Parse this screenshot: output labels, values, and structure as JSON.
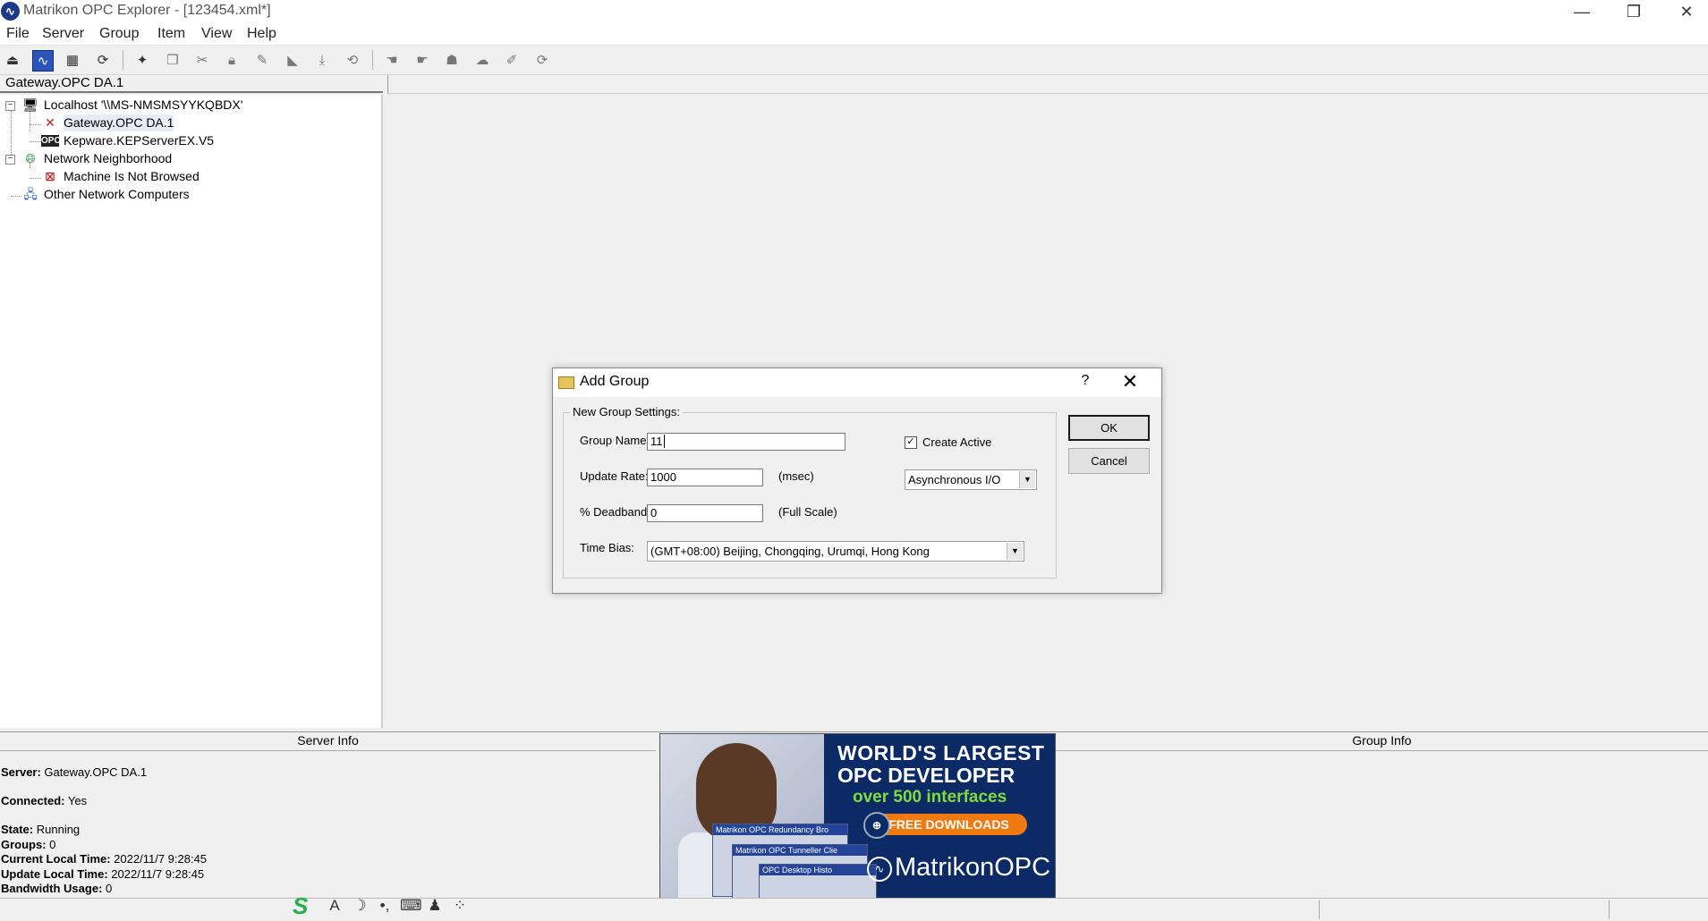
{
  "window": {
    "title": "Matrikon OPC Explorer - [123454.xml*]",
    "minimize_glyph": "—",
    "restore_glyph": "❐",
    "close_glyph": "✕"
  },
  "menu": [
    "File",
    "Server",
    "Group",
    "Item",
    "View",
    "Help"
  ],
  "tree": {
    "header": "Gateway.OPC DA.1",
    "nodes": [
      {
        "label": "Localhost '\\\\MS-NMSMSYYKQBDX'",
        "icon": "computer-icon"
      },
      {
        "label": "Gateway.OPC DA.1",
        "icon": "opc-server-icon"
      },
      {
        "label": "Kepware.KEPServerEX.V5",
        "icon": "opc-server-icon"
      },
      {
        "label": "Network Neighborhood",
        "icon": "globe-icon"
      },
      {
        "label": "Machine Is Not Browsed",
        "icon": "machine-not-browsed-icon"
      },
      {
        "label": "Other Network Computers",
        "icon": "network-computers-icon"
      }
    ]
  },
  "server_info": {
    "header": "Server Info",
    "rows": [
      {
        "key": "Server:",
        "value": " Gateway.OPC DA.1"
      },
      {
        "key": "Connected:",
        "value": " Yes"
      },
      {
        "key": "State:",
        "value": " Running"
      },
      {
        "key": "Groups:",
        "value": " 0"
      },
      {
        "key": "Current Local Time:",
        "value": " 2022/11/7 9:28:45"
      },
      {
        "key": "Update Local Time:",
        "value": " 2022/11/7 9:28:45"
      },
      {
        "key": "Bandwidth Usage:",
        "value": " 0"
      }
    ]
  },
  "group_info": {
    "header": "Group Info"
  },
  "ad": {
    "line1": "WORLD'S LARGEST",
    "line2": "OPC DEVELOPER",
    "line3": "over 500 interfaces",
    "cta": "FREE DOWNLOADS",
    "logo": "MatrikonOPC",
    "screens": [
      "Matrikon OPC Redundancy Bro",
      "Matrikon OPC Tunneller Clie",
      "OPC Desktop Histo"
    ]
  },
  "dialog": {
    "title": "Add Group",
    "help_glyph": "?",
    "close_glyph": "✕",
    "groupbox_label": "New Group Settings:",
    "group_name_label": "Group Name:",
    "group_name_value": "11",
    "update_rate_label": "Update Rate:",
    "update_rate_value": "1000",
    "update_rate_unit": "(msec)",
    "deadband_label": "% Deadband:",
    "deadband_value": "0",
    "deadband_unit": "(Full Scale)",
    "time_bias_label": "Time Bias:",
    "time_bias_value": "(GMT+08:00) Beijing, Chongqing, Urumqi, Hong Kong",
    "create_active_label": "Create Active",
    "create_active_checked": true,
    "io_mode_value": "Asynchronous I/O",
    "ok_label": "OK",
    "cancel_label": "Cancel"
  },
  "ime": {
    "logo": "S",
    "icons": [
      "A",
      "☽",
      "•,",
      "⌨",
      "♟",
      "⁘"
    ]
  },
  "colors": {
    "accent": "#2b55b8",
    "ad_bg": "#0b2a66",
    "ad_green": "#7fdc3b",
    "ad_orange": "#f07a12"
  }
}
